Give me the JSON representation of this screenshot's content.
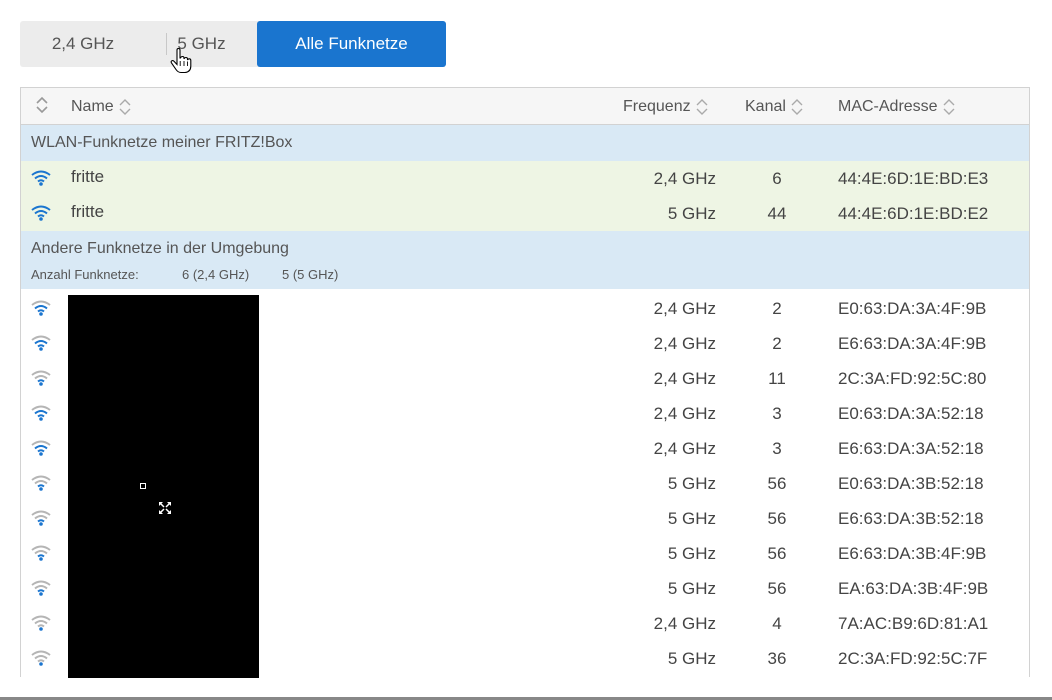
{
  "tabs": [
    {
      "label": "2,4 GHz",
      "active": false
    },
    {
      "label": "5 GHz",
      "active": false
    },
    {
      "label": "Alle Funknetze",
      "active": true
    }
  ],
  "table": {
    "headers": {
      "name": "Name",
      "frequency": "Frequenz",
      "channel": "Kanal",
      "mac": "MAC-Adresse"
    },
    "own_group": {
      "title": "WLAN-Funknetze meiner FRITZ!Box",
      "rows": [
        {
          "name": "fritte",
          "frequency": "2,4 GHz",
          "channel": "6",
          "mac": "44:4E:6D:1E:BD:E3"
        },
        {
          "name": "fritte",
          "frequency": "5 GHz",
          "channel": "44",
          "mac": "44:4E:6D:1E:BD:E2"
        }
      ]
    },
    "other_group": {
      "title": "Andere Funknetze in der Umgebung",
      "count_label": "Anzahl Funknetze:",
      "count_24": "6 (2,4 GHz)",
      "count_5": "5 (5 GHz)",
      "rows": [
        {
          "frequency": "2,4 GHz",
          "channel": "2",
          "mac": "E0:63:DA:3A:4F:9B",
          "signal": 2
        },
        {
          "frequency": "2,4 GHz",
          "channel": "2",
          "mac": "E6:63:DA:3A:4F:9B",
          "signal": 2
        },
        {
          "frequency": "2,4 GHz",
          "channel": "11",
          "mac": "2C:3A:FD:92:5C:80",
          "signal": 1
        },
        {
          "frequency": "2,4 GHz",
          "channel": "3",
          "mac": "E0:63:DA:3A:52:18",
          "signal": 2
        },
        {
          "frequency": "2,4 GHz",
          "channel": "3",
          "mac": "E6:63:DA:3A:52:18",
          "signal": 2
        },
        {
          "frequency": "5 GHz",
          "channel": "56",
          "mac": "E0:63:DA:3B:52:18",
          "signal": 1
        },
        {
          "frequency": "5 GHz",
          "channel": "56",
          "mac": "E6:63:DA:3B:52:18",
          "signal": 1
        },
        {
          "frequency": "5 GHz",
          "channel": "56",
          "mac": "E6:63:DA:3B:4F:9B",
          "signal": 1
        },
        {
          "frequency": "5 GHz",
          "channel": "56",
          "mac": "EA:63:DA:3B:4F:9B",
          "signal": 1
        },
        {
          "frequency": "2,4 GHz",
          "channel": "4",
          "mac": "7A:AC:B9:6D:81:A1",
          "signal": 0
        },
        {
          "frequency": "5 GHz",
          "channel": "36",
          "mac": "2C:3A:FD:92:5C:7F",
          "signal": 0
        }
      ]
    }
  },
  "colors": {
    "accent": "#1a75cf",
    "group_bg": "#d9e9f5",
    "own_row_bg": "#eef5e4",
    "wifi_blue": "#1a75cf",
    "wifi_grey": "#b5b5b5"
  }
}
